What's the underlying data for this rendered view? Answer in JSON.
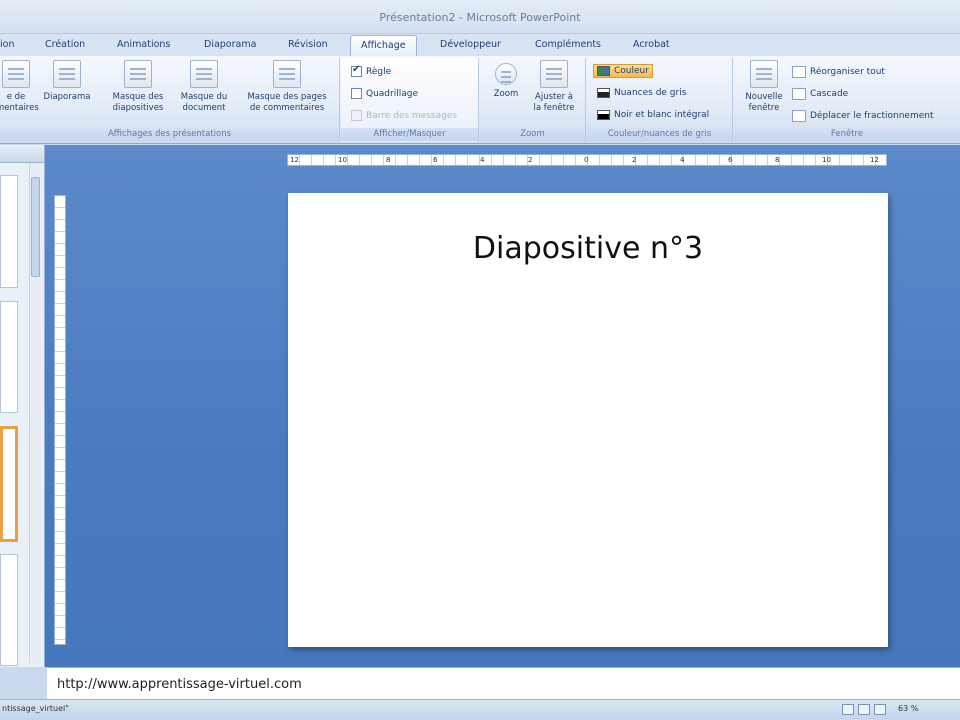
{
  "window": {
    "title": "Présentation2 - Microsoft PowerPoint"
  },
  "tabs": [
    "ion",
    "Création",
    "Animations",
    "Diaporama",
    "Révision",
    "Affichage",
    "Développeur",
    "Compléments",
    "Acrobat"
  ],
  "active_tab": "Affichage",
  "ribbon": {
    "groups": {
      "views": {
        "label": "Affichages des présentations",
        "buttons": [
          {
            "label": "e de\nmentaires",
            "icon": "notes-page-icon"
          },
          {
            "label": "Diaporama",
            "icon": "slideshow-icon"
          },
          {
            "label": "Masque des\ndiapositives",
            "icon": "slide-master-icon"
          },
          {
            "label": "Masque du\ndocument",
            "icon": "handout-master-icon"
          },
          {
            "label": "Masque des pages\nde commentaires",
            "icon": "notes-master-icon"
          }
        ]
      },
      "show_hide": {
        "label": "Afficher/Masquer",
        "items": [
          {
            "label": "Règle",
            "checked": true,
            "enabled": true
          },
          {
            "label": "Quadrillage",
            "checked": false,
            "enabled": true
          },
          {
            "label": "Barre des messages",
            "checked": false,
            "enabled": false
          }
        ]
      },
      "zoom": {
        "label": "Zoom",
        "buttons": [
          {
            "label": "Zoom",
            "icon": "magnifier-icon"
          },
          {
            "label": "Ajuster à\nla fenêtre",
            "icon": "fit-window-icon"
          }
        ]
      },
      "color": {
        "label": "Couleur/nuances de gris",
        "items": [
          {
            "label": "Couleur",
            "selected": true
          },
          {
            "label": "Nuances de gris",
            "selected": false
          },
          {
            "label": "Noir et blanc intégral",
            "selected": false
          }
        ]
      },
      "window": {
        "label": "Fenêtre",
        "big_button": {
          "label": "Nouvelle\nfenêtre",
          "icon": "new-window-icon"
        },
        "items": [
          {
            "label": "Réorganiser tout",
            "icon": "arrange-all-icon"
          },
          {
            "label": "Cascade",
            "icon": "cascade-icon"
          },
          {
            "label": "Déplacer le fractionnement",
            "icon": "move-split-icon"
          }
        ]
      }
    }
  },
  "ruler": {
    "h_labels": [
      "12",
      "10",
      "8",
      "6",
      "4",
      "2",
      "0",
      "2",
      "4",
      "6",
      "8",
      "10",
      "12"
    ]
  },
  "slide": {
    "title": "Diapositive n°3"
  },
  "notes": {
    "text": "http://www.apprentissage-virtuel.com"
  },
  "status": {
    "left_text": "ntissage_virtuel\"",
    "zoom": "63 %"
  }
}
